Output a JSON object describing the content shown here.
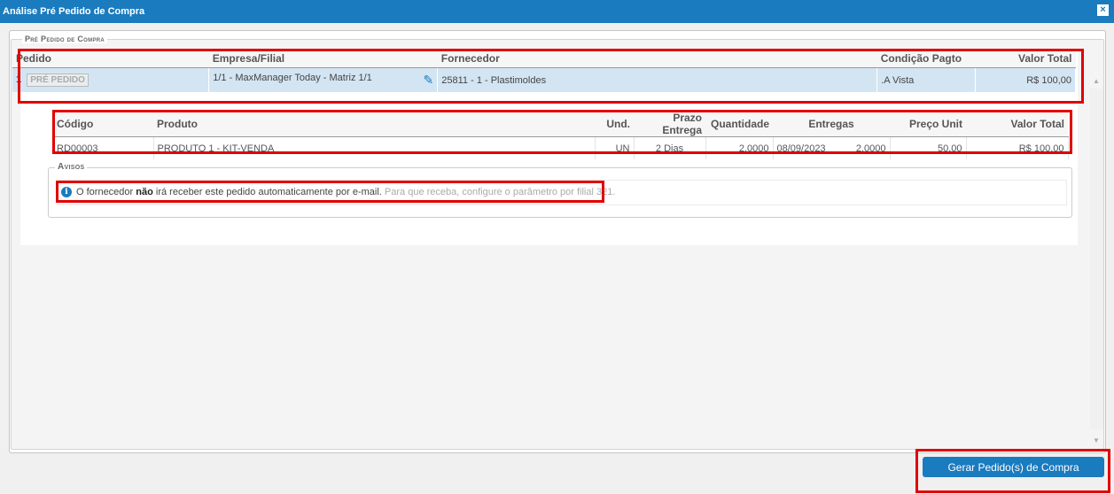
{
  "window": {
    "title": "Análise Pré Pedido de Compra",
    "close_label": "×"
  },
  "fieldset_legend": "Pré Pedido de Compra",
  "main_table": {
    "headers": {
      "pedido": "Pedido",
      "empresa": "Empresa/Filial",
      "fornecedor": "Fornecedor",
      "condicao": "Condição Pagto",
      "valor": "Valor Total"
    },
    "row": {
      "numero": "1",
      "status": "PRÉ PEDIDO",
      "empresa": "1/1 - MaxManager Today - Matriz 1/1",
      "fornecedor": "25811 - 1 - Plastimoldes",
      "condicao": ".A Vista",
      "valor": "R$ 100,00"
    }
  },
  "items_table": {
    "headers": {
      "codigo": "Código",
      "produto": "Produto",
      "und": "Und.",
      "prazo": "Prazo Entrega",
      "quantidade": "Quantidade",
      "entregas": "Entregas",
      "preco": "Preço Unit",
      "valor": "Valor Total"
    },
    "rows": [
      {
        "codigo": "RD00003",
        "produto": "PRODUTO 1 - KIT-VENDA",
        "und": "UN",
        "prazo": "2 Dias",
        "quantidade": "2,0000",
        "entrega_data": "08/09/2023",
        "entrega_qtd": "2,0000",
        "preco": "50,00",
        "valor": "R$ 100,00"
      }
    ]
  },
  "avisos": {
    "legend": "Avisos",
    "text_before": "O fornecedor ",
    "text_bold": "não",
    "text_after": " irá receber este pedido automaticamente por e-mail.",
    "hint": " Para que receba, configure o parâmetro por filial 321."
  },
  "footer": {
    "button_label": "Gerar Pedido(s) de Compra"
  }
}
